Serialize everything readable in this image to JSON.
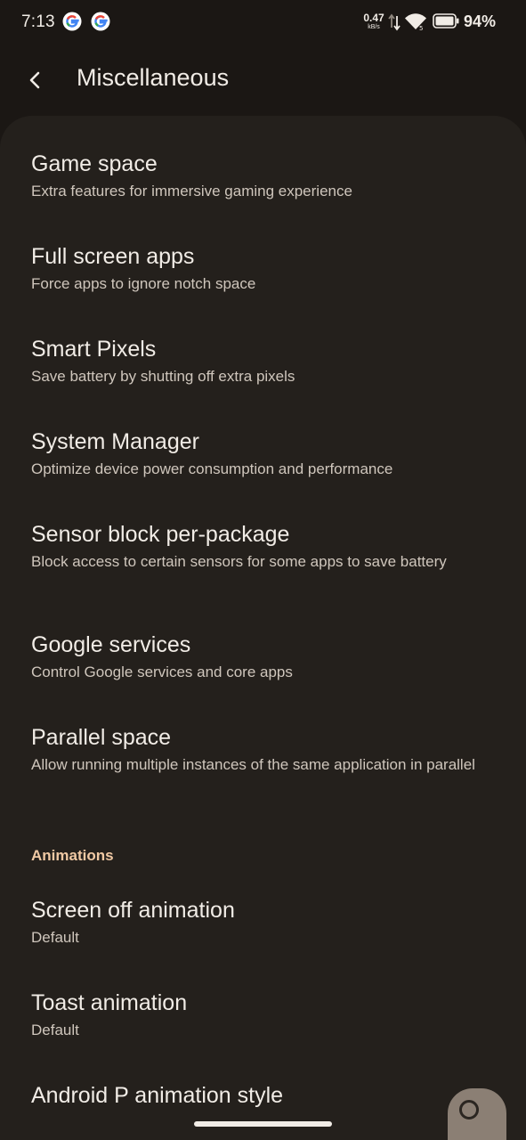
{
  "status_bar": {
    "time": "7:13",
    "net_speed_value": "0.47",
    "net_speed_unit": "kB/s",
    "battery_percent": "94%",
    "icons": [
      "google-icon",
      "google-icon",
      "data-arrows-icon",
      "wifi-icon",
      "battery-icon"
    ]
  },
  "toolbar": {
    "title": "Miscellaneous",
    "back_icon": "back-arrow-icon"
  },
  "items": [
    {
      "title": "Game space",
      "summary": "Extra features for immersive gaming experience"
    },
    {
      "title": "Full screen apps",
      "summary": "Force apps to ignore notch space"
    },
    {
      "title": "Smart Pixels",
      "summary": "Save battery by shutting off extra pixels"
    },
    {
      "title": "System Manager",
      "summary": "Optimize device power consumption and performance"
    },
    {
      "title": "Sensor block per-package",
      "summary": "Block access to certain sensors for some apps to save battery"
    },
    {
      "title": "Google services",
      "summary": "Control Google services and core apps"
    },
    {
      "title": "Parallel space",
      "summary": "Allow running multiple instances of the same application in parallel"
    }
  ],
  "animations_section": {
    "header": "Animations",
    "items": [
      {
        "title": "Screen off animation",
        "summary": "Default"
      },
      {
        "title": "Toast animation",
        "summary": "Default"
      },
      {
        "title": "Android P animation style",
        "summary": ""
      }
    ]
  },
  "colors": {
    "background": "#1b1714",
    "surface": "#24201c",
    "accent": "#f0c9a4",
    "text_primary": "#f1ece6",
    "text_secondary": "#cfc6bc"
  }
}
